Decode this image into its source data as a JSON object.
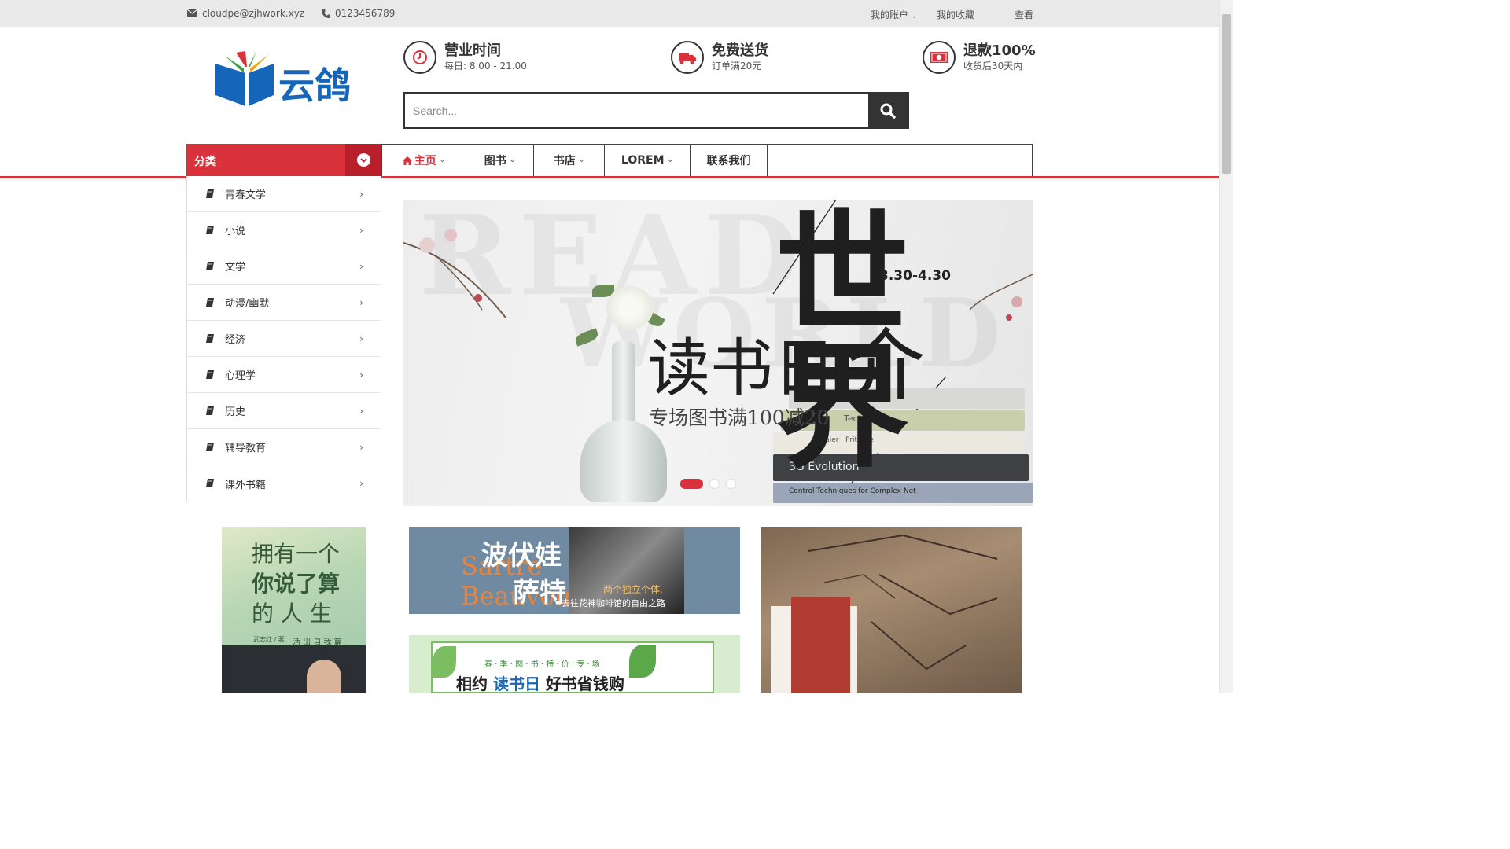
{
  "topbar": {
    "email": "cloudpe@zjhwork.xyz",
    "phone": "0123456789",
    "account": "我的账户",
    "favorites": "我的收藏",
    "view": "查看"
  },
  "brand": {
    "name": "云鸽",
    "colors": {
      "blue": "#1565b8",
      "green": "#3da042",
      "yellow": "#f2a51a",
      "red": "#d9323c"
    }
  },
  "features": [
    {
      "icon": "clock-icon",
      "title": "营业时间",
      "sub": "每日: 8.00 - 21.00"
    },
    {
      "icon": "truck-icon",
      "title": "免费送货",
      "sub": "订单满20元"
    },
    {
      "icon": "money-icon",
      "title": "退款100%",
      "sub": "收货后30天内"
    }
  ],
  "search": {
    "placeholder": "Search..."
  },
  "nav": {
    "category_label": "分类",
    "items": [
      {
        "label": "主页",
        "has_dropdown": true,
        "active": true
      },
      {
        "label": "图书",
        "has_dropdown": true
      },
      {
        "label": "书店",
        "has_dropdown": true
      },
      {
        "label": "LOREM",
        "has_dropdown": true
      },
      {
        "label": "联系我们",
        "has_dropdown": false
      }
    ]
  },
  "categories": [
    "青春文学",
    "小说",
    "文学",
    "动漫/幽默",
    "经济",
    "心理学",
    "历史",
    "辅导教育",
    "课外书籍"
  ],
  "banner": {
    "date": "3.30-4.30",
    "title_big": "世界",
    "title_main": "读书日",
    "title_end": "介",
    "subtitle": "专场图书满100减20",
    "bg_word1": "READ",
    "bg_word2": "WORLD",
    "book1": "3G Evolution",
    "book2": "Control Techniques for Complex Net",
    "book3": "Baier · Pritsche",
    "book4": "Technol",
    "slides": 3,
    "active_slide": 1
  },
  "promos": {
    "p1": {
      "line1": "拥有一个",
      "line2": "你说了算",
      "line3": "的 人 生",
      "tag": "活 出 自 我 篇",
      "author": "武志红 / 著"
    },
    "p2": {
      "title1": "波伏娃",
      "title2": "萨特",
      "en1": "Sartre",
      "en2": "Beauvoir",
      "caption1": "两个独立个体,",
      "caption2": "去往花神咖啡馆的自由之路"
    },
    "p3": {
      "top": "春 · 季 · 图 · 书 · 特 · 价 · 专 · 场",
      "main_a": "相约",
      "main_b": "读书日",
      "main_c": "好书省钱购"
    }
  }
}
